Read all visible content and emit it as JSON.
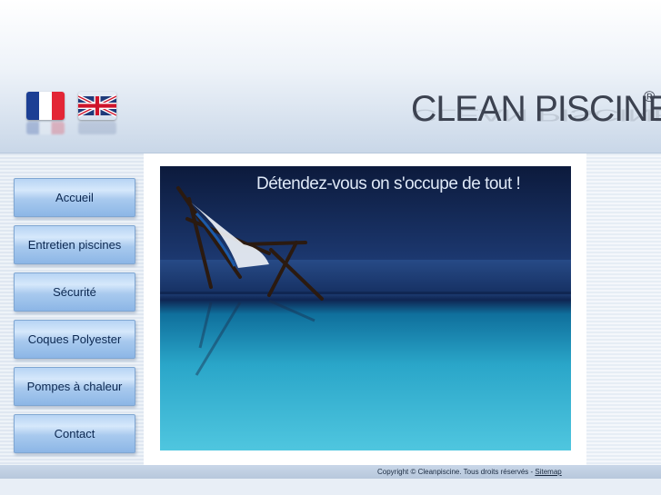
{
  "header": {
    "logo_text": "CLEAN PISCINE",
    "registered_mark": "®",
    "languages": [
      {
        "name": "fr-flag-icon",
        "colors": [
          "#1c3f94",
          "#ffffff",
          "#e32636"
        ]
      },
      {
        "name": "uk-flag-icon",
        "colors": [
          "#1f3a7a",
          "#ffffff",
          "#cf142b"
        ]
      }
    ]
  },
  "nav": {
    "items": [
      {
        "label": "Accueil"
      },
      {
        "label": "Entretien piscines"
      },
      {
        "label": "Sécurité"
      },
      {
        "label": "Coques Polyester"
      },
      {
        "label": "Pompes à chaleur"
      },
      {
        "label": "Contact"
      }
    ]
  },
  "hero": {
    "tagline": "Détendez-vous on s'occupe de tout !"
  },
  "footer": {
    "copyright": "Copyright © Cleanpiscine. Tous droits réservés - ",
    "sitemap_label": "Sitemap"
  },
  "colors": {
    "header_top": "#ffffff",
    "header_bottom": "#c9d7e8",
    "button_text": "#0b2750",
    "logo": "#3c4250"
  }
}
